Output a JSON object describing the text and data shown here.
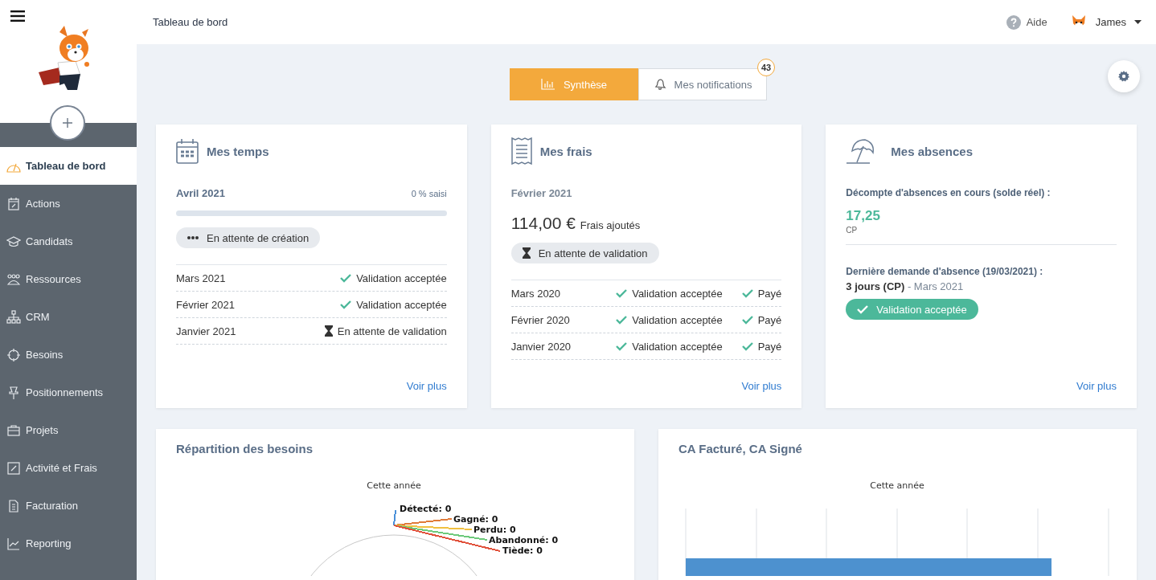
{
  "sidebar": {
    "items": [
      {
        "label": "Tableau de bord",
        "selected": true
      },
      {
        "label": "Actions",
        "selected": false
      },
      {
        "label": "Candidats",
        "selected": false
      },
      {
        "label": "Ressources",
        "selected": false
      },
      {
        "label": "CRM",
        "selected": false
      },
      {
        "label": "Besoins",
        "selected": false
      },
      {
        "label": "Positionnements",
        "selected": false
      },
      {
        "label": "Projets",
        "selected": false
      },
      {
        "label": "Activité et Frais",
        "selected": false
      },
      {
        "label": "Facturation",
        "selected": false
      },
      {
        "label": "Reporting",
        "selected": false
      }
    ]
  },
  "header": {
    "title": "Tableau de bord",
    "help": "Aide",
    "user": "James"
  },
  "tabs": [
    {
      "label": "Synthèse",
      "selected": true
    },
    {
      "label": "Mes notifications",
      "selected": false,
      "badge": "43"
    }
  ],
  "temps": {
    "title": "Mes temps",
    "period": "Avril 2021",
    "progress_label": "0 % saisi",
    "level": 0,
    "status": {
      "kind": "creation",
      "label": "En attente de création"
    },
    "rows": [
      {
        "month": "Mars 2021",
        "status": {
          "kind": "accepted",
          "label": "Validation acceptée"
        }
      },
      {
        "month": "Février 2021",
        "status": {
          "kind": "accepted",
          "label": "Validation acceptée"
        }
      },
      {
        "month": "Janvier 2021",
        "status": {
          "kind": "pending",
          "label": "En attente de validation"
        }
      }
    ],
    "link": "Voir plus"
  },
  "frais": {
    "title": "Mes frais",
    "period": "Février 2021",
    "amount": "114,00 €",
    "amount_note": "Frais ajoutés",
    "status": {
      "kind": "pending",
      "label": "En attente de validation"
    },
    "rows": [
      {
        "month": "Mars 2020",
        "status": {
          "kind": "accepted",
          "label": "Validation acceptée"
        },
        "payment": {
          "kind": "accepted",
          "label": "Payé"
        }
      },
      {
        "month": "Février 2020",
        "status": {
          "kind": "accepted",
          "label": "Validation acceptée"
        },
        "payment": {
          "kind": "accepted",
          "label": "Payé"
        }
      },
      {
        "month": "Janvier 2020",
        "status": {
          "kind": "accepted",
          "label": "Validation acceptée"
        },
        "payment": {
          "kind": "accepted",
          "label": "Payé"
        }
      }
    ],
    "link": "Voir plus"
  },
  "absences": {
    "title": "Mes absences",
    "balance_label": "Décompte d'absences en cours (solde réel) :",
    "balance": "17,25",
    "unit": "CP",
    "last_label": "Dernière demande d'absence (19/03/2021) :",
    "last_detail": "**3 jours (CP)** - Mars 2021",
    "last_status": {
      "kind": "accepted",
      "label": "Validation acceptée"
    },
    "link": "Voir plus"
  },
  "besoins": {
    "title": "Répartition des besoins",
    "chart_title": "Cette année",
    "labels": [
      {
        "label": "Détecté: 0",
        "color": "#4a90d9"
      },
      {
        "label": "Gagné: 0",
        "color": "#e07b39"
      },
      {
        "label": "Perdu: 0",
        "color": "#f0c040"
      },
      {
        "label": "Abandonné: 0",
        "color": "#6cc97a"
      },
      {
        "label": "Tiède: 0",
        "color": "#e0503a"
      }
    ]
  },
  "ca": {
    "title": "CA Facturé, CA Signé",
    "chart_title": "Cette année"
  }
}
